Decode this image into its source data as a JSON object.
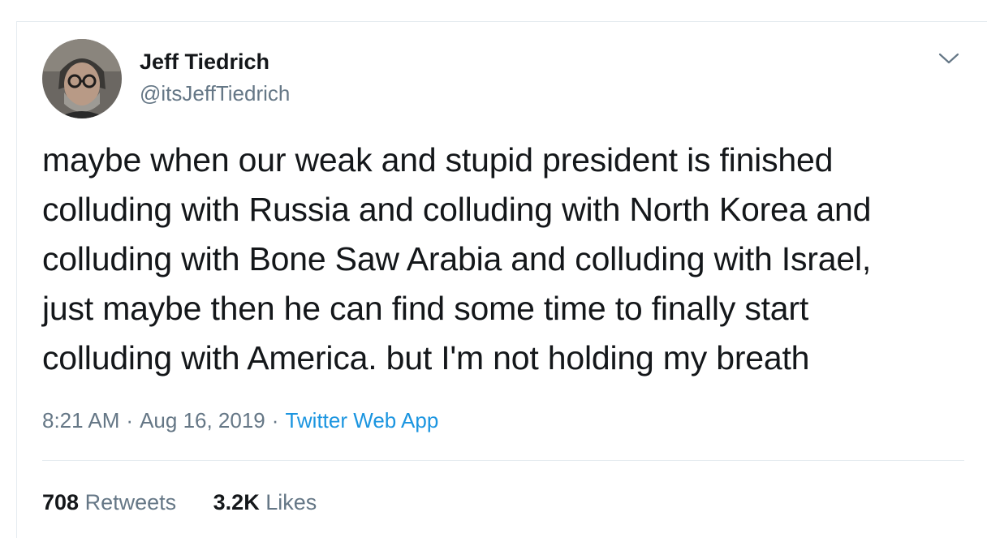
{
  "tweet": {
    "author": {
      "display_name": "Jeff Tiedrich",
      "handle": "@itsJeffTiedrich"
    },
    "text_lines": [
      "maybe when our weak and stupid president is finished",
      "colluding with Russia and colluding with North Korea and",
      "colluding with Bone Saw Arabia and colluding with Israel,",
      "just maybe then he can find some time to finally start",
      "colluding with America. but I'm not holding my breath"
    ],
    "meta": {
      "time": "8:21 AM",
      "separator": "·",
      "date": "Aug 16, 2019",
      "source": "Twitter Web App"
    },
    "stats": {
      "retweets_count": "708",
      "retweets_label": "Retweets",
      "likes_count": "3.2K",
      "likes_label": "Likes"
    }
  },
  "icons": {
    "caret": "chevron-down-icon"
  },
  "colors": {
    "text": "#14171a",
    "secondary": "#657786",
    "link": "#1b95e0",
    "divider": "#e6ecf0"
  }
}
